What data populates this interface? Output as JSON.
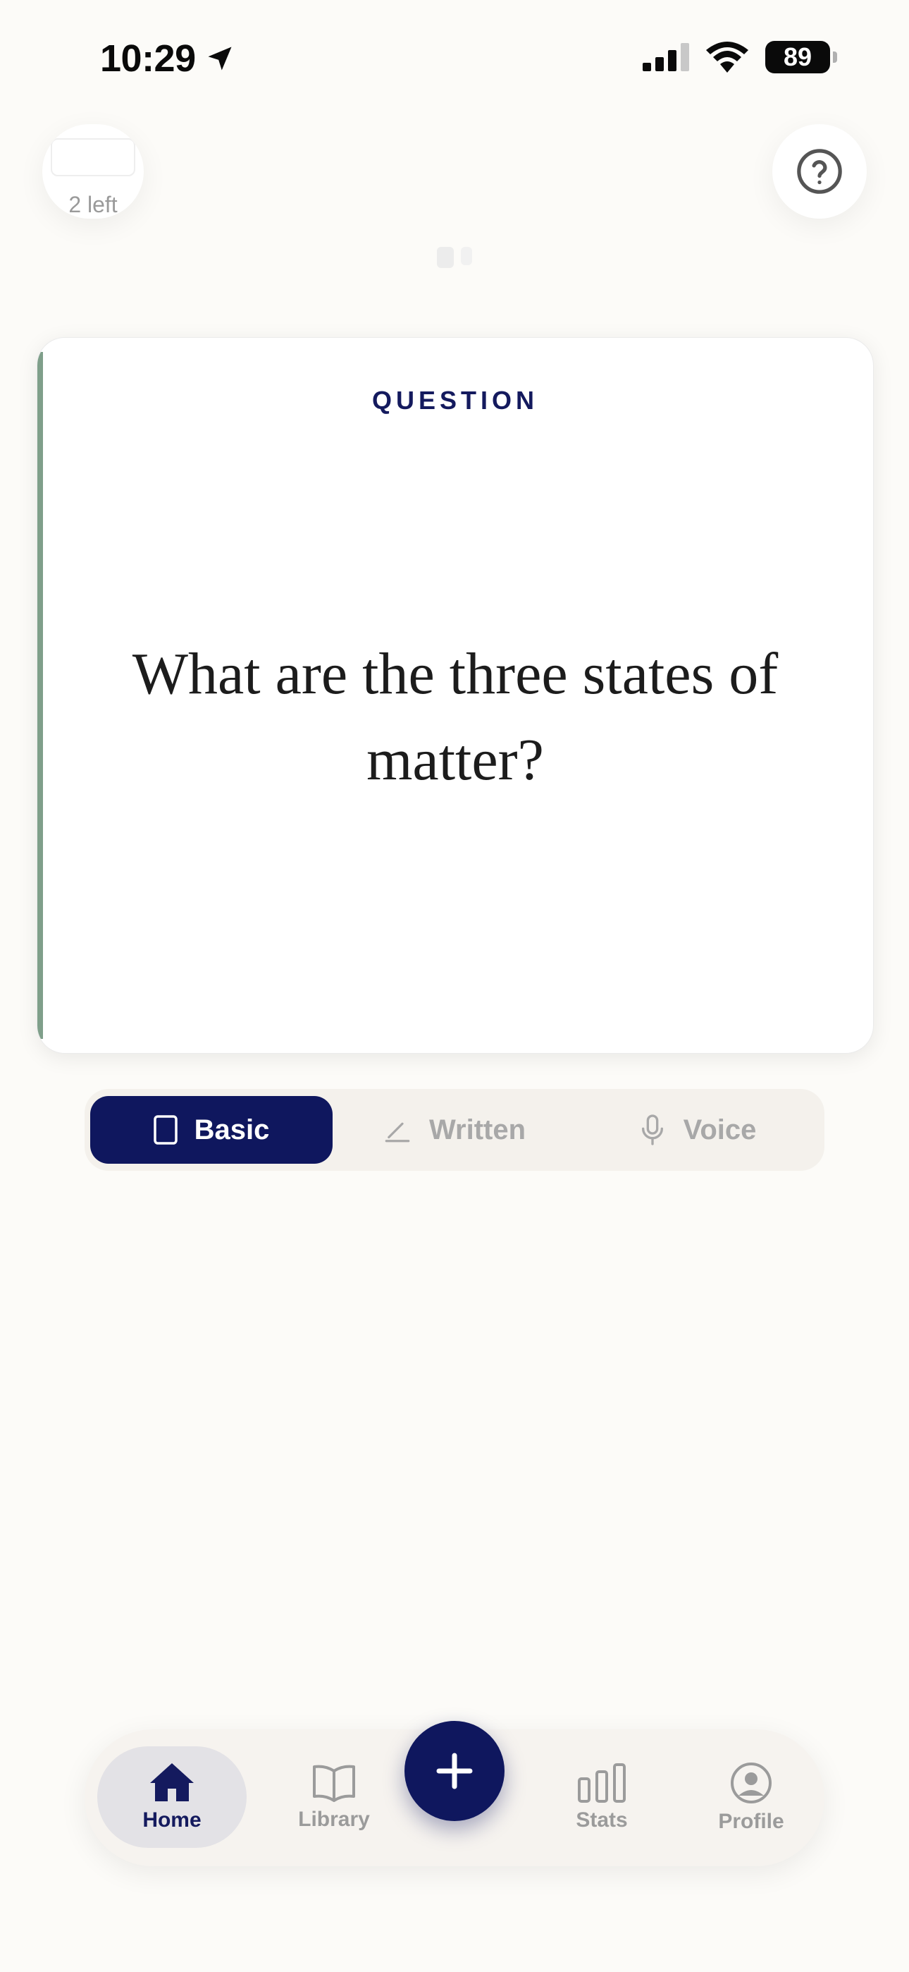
{
  "status_bar": {
    "time": "10:29",
    "battery": "89"
  },
  "header": {
    "left_text": "2 left"
  },
  "card": {
    "label": "QUESTION",
    "question": "What are the three states of matter?"
  },
  "modes": [
    {
      "label": "Basic",
      "icon": "card-icon",
      "active": true
    },
    {
      "label": "Written",
      "icon": "pen-icon",
      "active": false
    },
    {
      "label": "Voice",
      "icon": "mic-icon",
      "active": false
    }
  ],
  "nav": {
    "items": [
      {
        "label": "Home",
        "icon": "home-icon",
        "active": true
      },
      {
        "label": "Library",
        "icon": "book-icon",
        "active": false
      },
      {
        "label": "Stats",
        "icon": "stats-icon",
        "active": false
      },
      {
        "label": "Profile",
        "icon": "profile-icon",
        "active": false
      }
    ],
    "fab_icon": "plus-icon"
  },
  "colors": {
    "accent": "#0f175e",
    "card_stripe": "#7f9f8a",
    "background": "#fcfbf8"
  }
}
